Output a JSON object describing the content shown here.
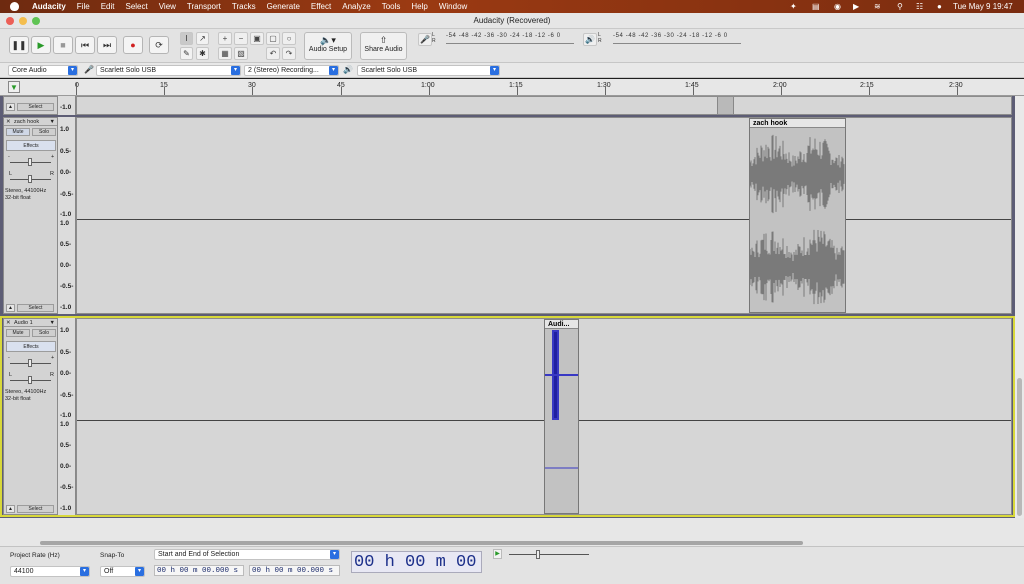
{
  "menubar": {
    "app": "Audacity",
    "items": [
      "File",
      "Edit",
      "Select",
      "View",
      "Transport",
      "Tracks",
      "Generate",
      "Effect",
      "Analyze",
      "Tools",
      "Help",
      "Window"
    ],
    "clock": "Tue May 9  19:47"
  },
  "window": {
    "title": "Audacity (Recovered)"
  },
  "toolbar": {
    "audio_setup_label": "Audio Setup",
    "share_audio_label": "Share Audio",
    "rec_meter_l": "R",
    "rec_meter_r": "L",
    "rec_meter_scale": "-54 -48 -42 -36 -30 -24 -18 -12 -6 0",
    "play_meter_scale": "-54 -48 -42 -36 -30 -24 -18 -12 -6 0"
  },
  "devices": {
    "host": "Core Audio",
    "recording_device": "Scarlett Solo USB",
    "channels": "2 (Stereo) Recording...",
    "playback_device": "Scarlett Solo USB"
  },
  "ruler": {
    "ticks": [
      "0",
      "15",
      "30",
      "45",
      "1:00",
      "1:15",
      "1:30",
      "1:45",
      "2:00",
      "2:15",
      "2:30"
    ]
  },
  "tracks": {
    "top": {
      "select_label": "Select",
      "scale_bottom": "-1.0"
    },
    "zach": {
      "name": "zach hook",
      "mute": "Mute",
      "solo": "Solo",
      "effects": "Effects",
      "gain_minus": "-",
      "gain_plus": "+",
      "pan_l": "L",
      "pan_r": "R",
      "info1": "Stereo, 44100Hz",
      "info2": "32-bit float",
      "select_label": "Select",
      "clip_title": "zach hook",
      "scale": [
        "1.0",
        "0.5-",
        "0.0-",
        "-0.5-",
        "-1.0"
      ]
    },
    "audio1": {
      "name": "Audio 1",
      "mute": "Mute",
      "solo": "Solo",
      "effects": "Effects",
      "gain_minus": "-",
      "gain_plus": "+",
      "pan_l": "L",
      "pan_r": "R",
      "info1": "Stereo, 44100Hz",
      "info2": "32-bit float",
      "select_label": "Select",
      "clip_title": "Audi...",
      "scale": [
        "1.0",
        "0.5-",
        "0.0-",
        "-0.5-",
        "-1.0"
      ]
    }
  },
  "selection": {
    "project_rate_label": "Project Rate (Hz)",
    "project_rate_value": "44100",
    "snap_label": "Snap-To",
    "snap_value": "Off",
    "mode": "Start and End of Selection",
    "start": "00 h 00 m 00.000 s",
    "end": "00 h 00 m 00.000 s",
    "time": "00 h 00 m 00 s"
  },
  "colors": {
    "menubar": "#8a3410",
    "track_bg": "#d6d6d6",
    "waveform_gray": "#7a7a7a",
    "waveform_blue": "#3535c8",
    "selected_border": "#d8d83a"
  }
}
